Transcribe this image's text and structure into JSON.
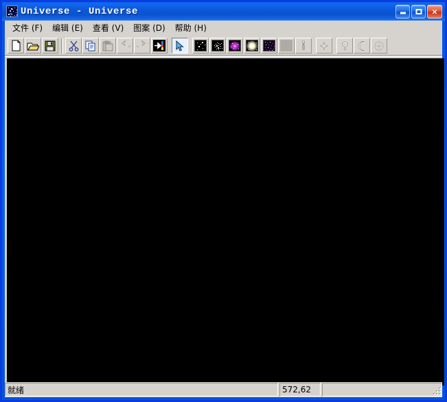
{
  "window": {
    "title": "Universe - Universe",
    "icon": "universe-starfield-icon",
    "controls": {
      "minimize_label": "",
      "maximize_label": "",
      "close_label": "×"
    }
  },
  "menubar": {
    "items": [
      {
        "label": "文件 (F)",
        "name": "menu-file"
      },
      {
        "label": "编辑 (E)",
        "name": "menu-edit"
      },
      {
        "label": "查看 (V)",
        "name": "menu-view"
      },
      {
        "label": "图案 (D)",
        "name": "menu-pattern"
      },
      {
        "label": "帮助 (H)",
        "name": "menu-help"
      }
    ]
  },
  "toolbar": {
    "buttons": [
      {
        "name": "new-file-button",
        "icon": "new-page-icon",
        "state": "enabled"
      },
      {
        "name": "open-file-button",
        "icon": "open-folder-icon",
        "state": "enabled"
      },
      {
        "name": "save-file-button",
        "icon": "floppy-disk-icon",
        "state": "enabled"
      },
      {
        "name": "cut-button",
        "icon": "scissors-icon",
        "state": "enabled"
      },
      {
        "name": "copy-button",
        "icon": "copy-icon",
        "state": "enabled"
      },
      {
        "name": "paste-button",
        "icon": "paste-icon",
        "state": "disabled"
      },
      {
        "name": "undo-button",
        "icon": "undo-arrow-icon",
        "state": "disabled"
      },
      {
        "name": "redo-button",
        "icon": "redo-arrow-icon",
        "state": "disabled"
      },
      {
        "name": "export-button",
        "icon": "arrow-to-bar-icon",
        "state": "enabled"
      },
      {
        "name": "select-tool-button",
        "icon": "arrow-cursor-icon",
        "state": "selected"
      },
      {
        "name": "stars-sparse-button",
        "icon": "sparse-stars-icon",
        "state": "enabled"
      },
      {
        "name": "stars-cluster-button",
        "icon": "star-cluster-icon",
        "state": "enabled"
      },
      {
        "name": "nebula-button",
        "icon": "purple-nebula-icon",
        "state": "enabled"
      },
      {
        "name": "nova-button",
        "icon": "white-nova-icon",
        "state": "enabled"
      },
      {
        "name": "starfield-button",
        "icon": "violet-starfield-icon",
        "state": "enabled"
      },
      {
        "name": "blank-pattern-button",
        "icon": "blank-swatch-icon",
        "state": "disabled"
      },
      {
        "name": "comet-button",
        "icon": "comet-icon",
        "state": "disabled"
      },
      {
        "name": "sparkle-button",
        "icon": "sparkle-star-icon",
        "state": "disabled"
      },
      {
        "name": "venus-button",
        "icon": "venus-symbol-icon",
        "state": "disabled"
      },
      {
        "name": "moon-button",
        "icon": "crescent-moon-icon",
        "state": "disabled"
      },
      {
        "name": "target-button",
        "icon": "crosshair-circle-icon",
        "state": "disabled"
      }
    ]
  },
  "canvas": {
    "name": "drawing-canvas",
    "background_color": "#000000"
  },
  "statusbar": {
    "message": "就绪",
    "coordinates": "572,62",
    "extra": ""
  },
  "colors": {
    "title_active": "#0b57d8",
    "face": "#d6d3ce",
    "canvas": "#000000",
    "close_button": "#c72f17"
  }
}
